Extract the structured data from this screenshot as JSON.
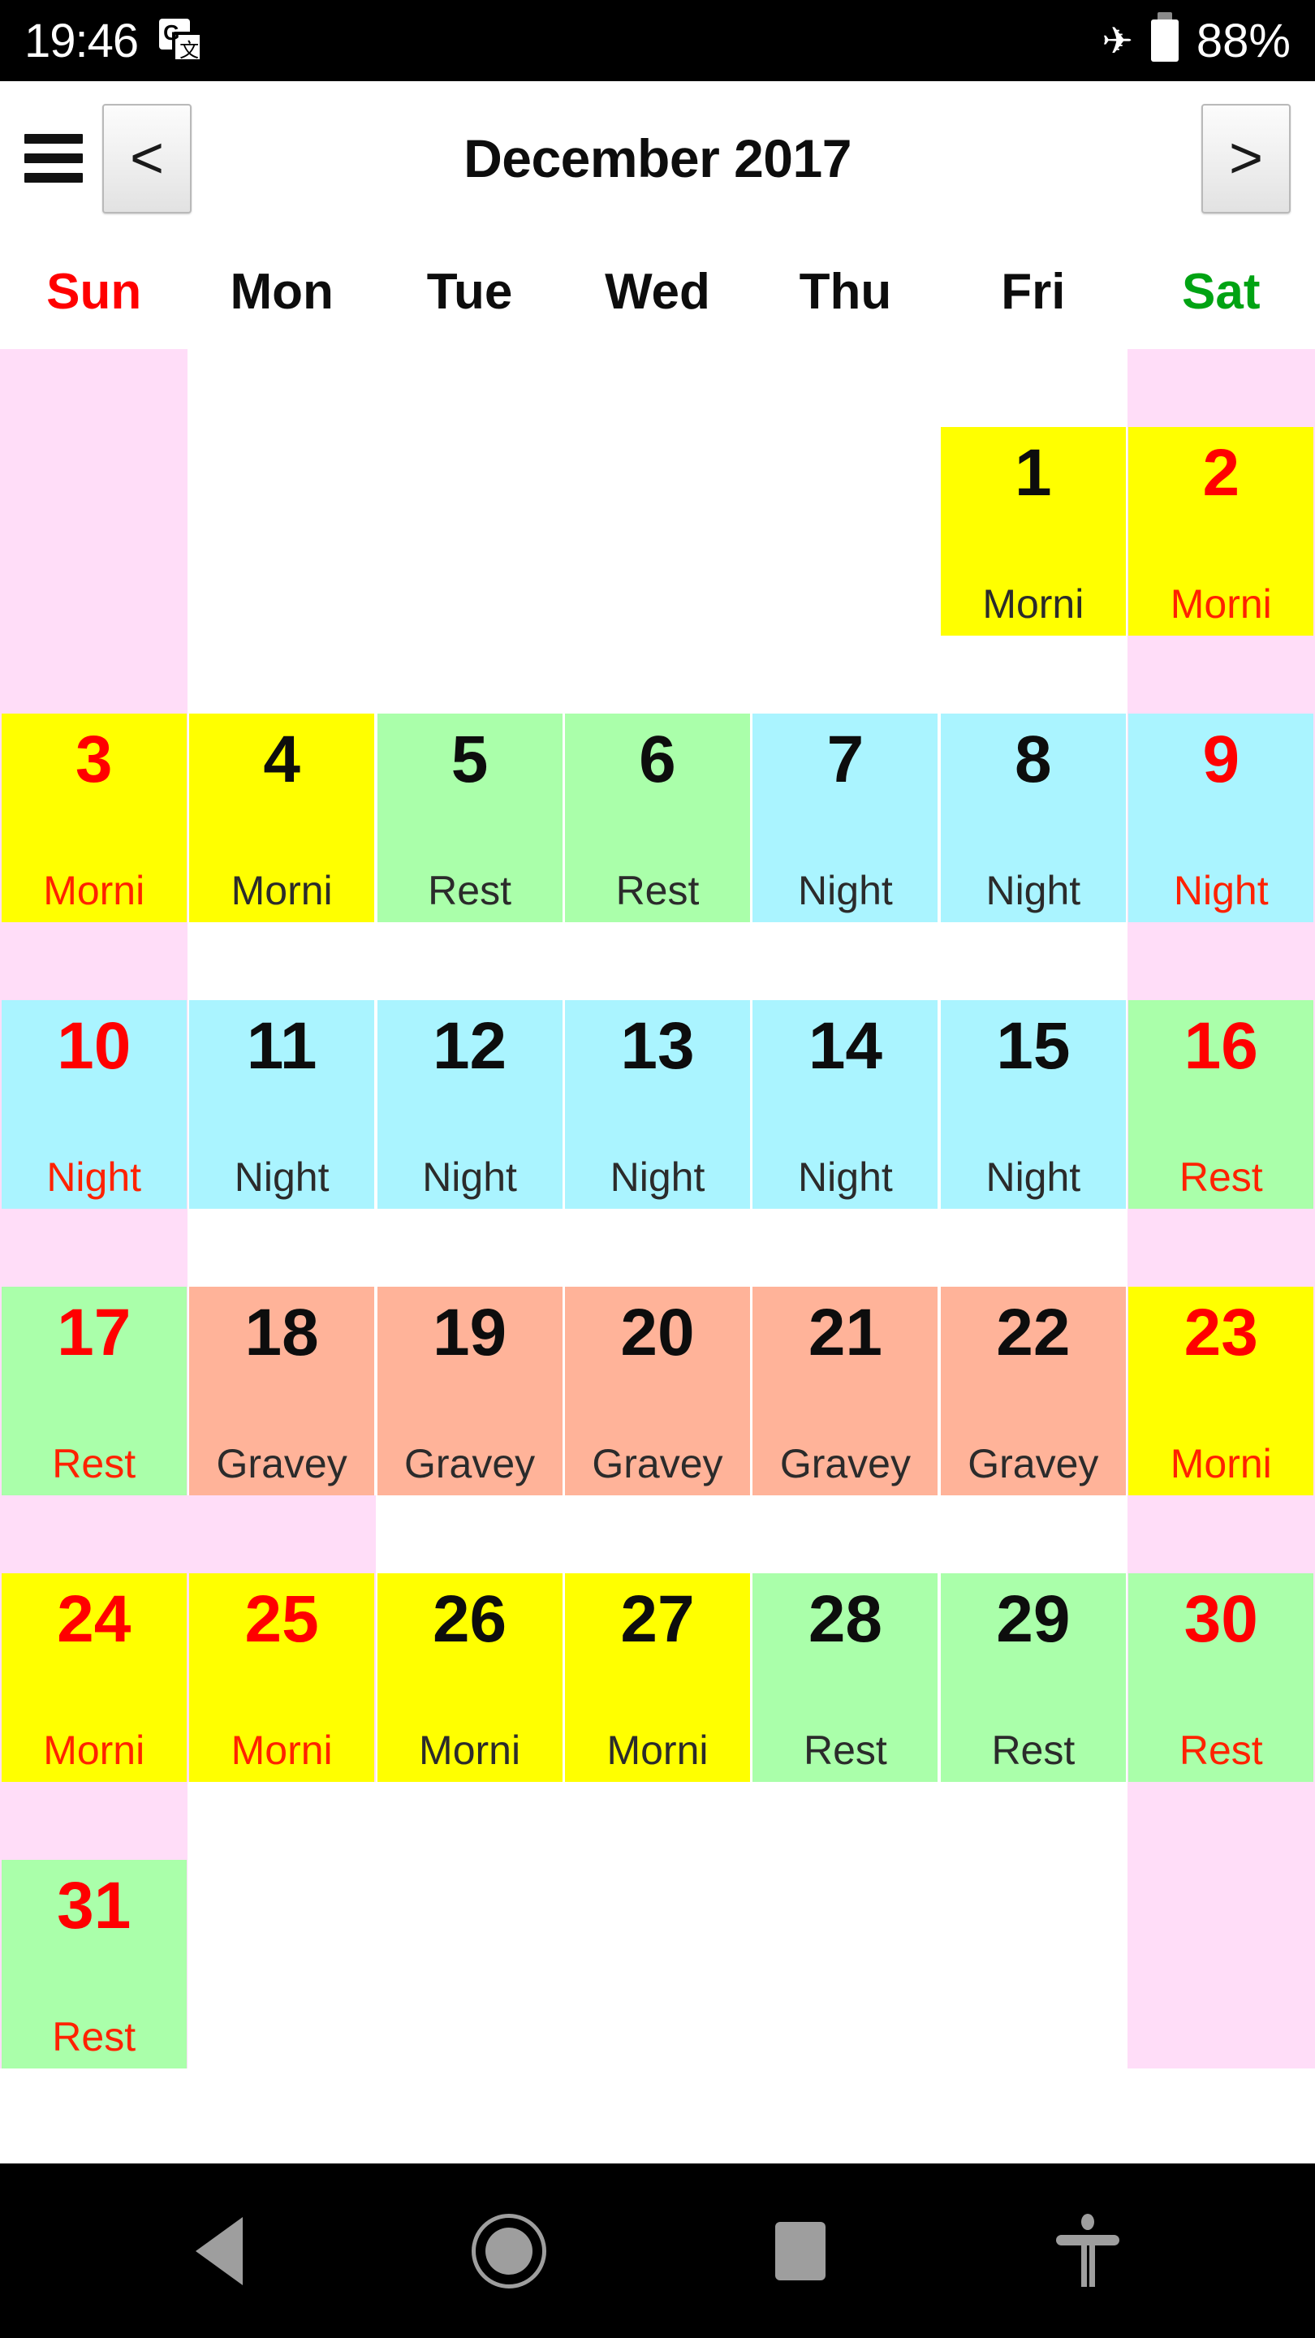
{
  "status_bar": {
    "clock": "19:46",
    "translate_icon_g": "G",
    "translate_icon_cjk": "文",
    "airplane_glyph": "✈",
    "battery_percent": "88%"
  },
  "header": {
    "menu_icon": "hamburger-menu-icon",
    "prev_label": "<",
    "next_label": ">",
    "title": "December 2017"
  },
  "weekdays": [
    {
      "label": "Sun",
      "color": "#ff0000"
    },
    {
      "label": "Mon",
      "color": "#0d0d0d"
    },
    {
      "label": "Tue",
      "color": "#0d0d0d"
    },
    {
      "label": "Wed",
      "color": "#0d0d0d"
    },
    {
      "label": "Thu",
      "color": "#0d0d0d"
    },
    {
      "label": "Fri",
      "color": "#0d0d0d"
    },
    {
      "label": "Sat",
      "color": "#00a313"
    }
  ],
  "shift_colors": {
    "morning": "#ffff00",
    "rest": "#aaffaa",
    "night": "#aaf4ff",
    "graveyard": "#ffb399",
    "weekend_column": "#ffddf8",
    "holiday_text": "#ff0000",
    "normal_text": "#0d0d0d"
  },
  "calendar": {
    "month": "December",
    "year": "2017",
    "leading_blanks": 5,
    "days": [
      {
        "n": "1",
        "label": "Morni",
        "shift": "morning",
        "holiday": false,
        "weekend_col": false
      },
      {
        "n": "2",
        "label": "Morni",
        "shift": "morning",
        "holiday": true,
        "weekend_col": true
      },
      {
        "n": "3",
        "label": "Morni",
        "shift": "morning",
        "holiday": true,
        "weekend_col": true
      },
      {
        "n": "4",
        "label": "Morni",
        "shift": "morning",
        "holiday": false,
        "weekend_col": false
      },
      {
        "n": "5",
        "label": "Rest",
        "shift": "rest",
        "holiday": false,
        "weekend_col": false
      },
      {
        "n": "6",
        "label": "Rest",
        "shift": "rest",
        "holiday": false,
        "weekend_col": false
      },
      {
        "n": "7",
        "label": "Night",
        "shift": "night",
        "holiday": false,
        "weekend_col": false
      },
      {
        "n": "8",
        "label": "Night",
        "shift": "night",
        "holiday": false,
        "weekend_col": false
      },
      {
        "n": "9",
        "label": "Night",
        "shift": "night",
        "holiday": true,
        "weekend_col": true
      },
      {
        "n": "10",
        "label": "Night",
        "shift": "night",
        "holiday": true,
        "weekend_col": true
      },
      {
        "n": "11",
        "label": "Night",
        "shift": "night",
        "holiday": false,
        "weekend_col": false
      },
      {
        "n": "12",
        "label": "Night",
        "shift": "night",
        "holiday": false,
        "weekend_col": false
      },
      {
        "n": "13",
        "label": "Night",
        "shift": "night",
        "holiday": false,
        "weekend_col": false
      },
      {
        "n": "14",
        "label": "Night",
        "shift": "night",
        "holiday": false,
        "weekend_col": false
      },
      {
        "n": "15",
        "label": "Night",
        "shift": "night",
        "holiday": false,
        "weekend_col": false
      },
      {
        "n": "16",
        "label": "Rest",
        "shift": "rest",
        "holiday": true,
        "weekend_col": true
      },
      {
        "n": "17",
        "label": "Rest",
        "shift": "rest",
        "holiday": true,
        "weekend_col": true
      },
      {
        "n": "18",
        "label": "Gravey",
        "shift": "graveyard",
        "holiday": false,
        "weekend_col": false
      },
      {
        "n": "19",
        "label": "Gravey",
        "shift": "graveyard",
        "holiday": false,
        "weekend_col": false
      },
      {
        "n": "20",
        "label": "Gravey",
        "shift": "graveyard",
        "holiday": false,
        "weekend_col": false
      },
      {
        "n": "21",
        "label": "Gravey",
        "shift": "graveyard",
        "holiday": false,
        "weekend_col": false
      },
      {
        "n": "22",
        "label": "Gravey",
        "shift": "graveyard",
        "holiday": false,
        "weekend_col": false
      },
      {
        "n": "23",
        "label": "Morni",
        "shift": "morning",
        "holiday": true,
        "weekend_col": true
      },
      {
        "n": "24",
        "label": "Morni",
        "shift": "morning",
        "holiday": true,
        "weekend_col": true
      },
      {
        "n": "25",
        "label": "Morni",
        "shift": "morning",
        "holiday": true,
        "weekend_col": true
      },
      {
        "n": "26",
        "label": "Morni",
        "shift": "morning",
        "holiday": false,
        "weekend_col": false
      },
      {
        "n": "27",
        "label": "Morni",
        "shift": "morning",
        "holiday": false,
        "weekend_col": false
      },
      {
        "n": "28",
        "label": "Rest",
        "shift": "rest",
        "holiday": false,
        "weekend_col": false
      },
      {
        "n": "29",
        "label": "Rest",
        "shift": "rest",
        "holiday": false,
        "weekend_col": false
      },
      {
        "n": "30",
        "label": "Rest",
        "shift": "rest",
        "holiday": true,
        "weekend_col": true
      },
      {
        "n": "31",
        "label": "Rest",
        "shift": "rest",
        "holiday": true,
        "weekend_col": true
      }
    ],
    "trailing_blanks": 6
  },
  "nav_bar": {
    "back": "back-triangle-icon",
    "home": "home-circle-icon",
    "recents": "recents-square-icon",
    "accessibility": "accessibility-person-icon"
  }
}
